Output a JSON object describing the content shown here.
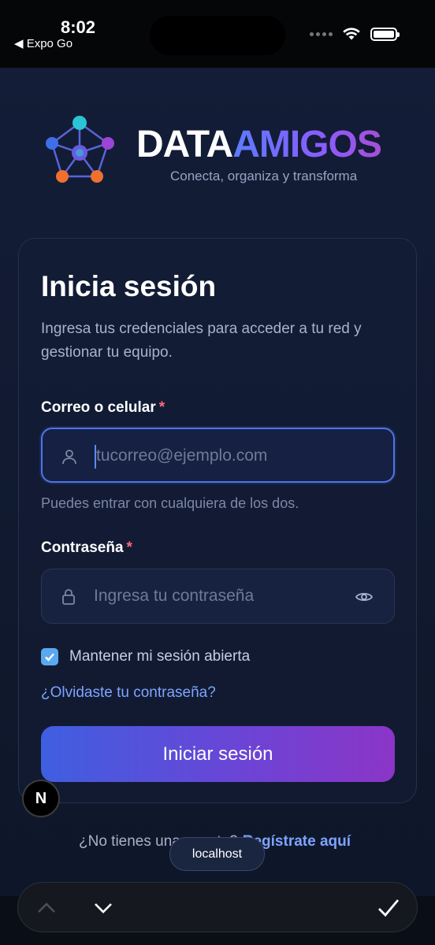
{
  "status_bar": {
    "time": "8:02",
    "back_label": "◀ Expo Go"
  },
  "brand": {
    "name_part1": "DATA",
    "name_part2": "AMIGOS",
    "tagline": "Conecta, organiza y transforma",
    "colors": {
      "accent_blue": "#5c7cff",
      "accent_purple": "#a64fd6",
      "node_cyan": "#2bc4d6",
      "node_orange": "#f0702e"
    }
  },
  "login": {
    "title": "Inicia sesión",
    "subtitle": "Ingresa tus credenciales para acceder a tu red y gestionar tu equipo.",
    "email_label": "Correo o celular",
    "email_required": "*",
    "email_placeholder": "tucorreo@ejemplo.com",
    "email_helper": "Puedes entrar con cualquiera de los dos.",
    "password_label": "Contraseña",
    "password_required": "*",
    "password_placeholder": "Ingresa tu contraseña",
    "remember_label": "Mantener mi sesión abierta",
    "remember_checked": true,
    "forgot_link": "¿Olvidaste tu contraseña?",
    "submit_label": "Iniciar sesión"
  },
  "signup": {
    "prompt": "¿No tienes una cuenta?",
    "link": "Regístrate aquí"
  },
  "dev": {
    "next_badge": "N",
    "host": "localhost"
  },
  "icons": {
    "user": "user-icon",
    "lock": "lock-icon",
    "eye": "eye-icon",
    "check": "check-icon",
    "chevron_up": "chevron-up-icon",
    "chevron_down": "chevron-down-icon"
  }
}
